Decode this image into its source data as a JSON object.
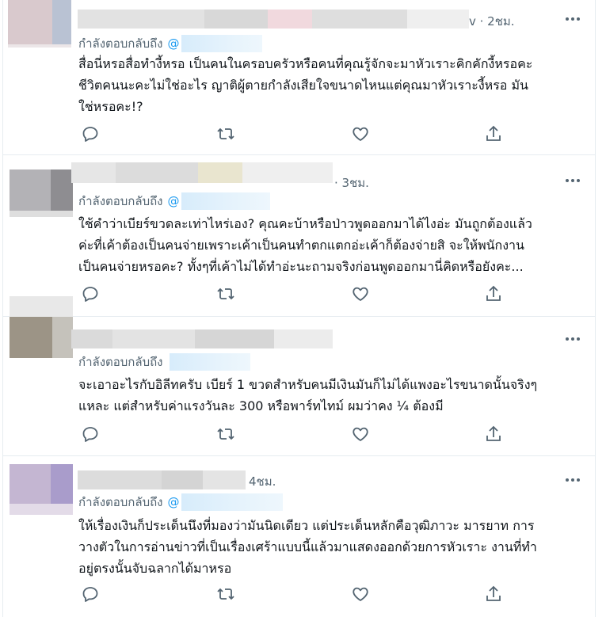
{
  "tweets": [
    {
      "time": "v · 2ชม.",
      "replying_to_label": "กำลังตอบกลับถึง",
      "at": "@",
      "lines": [
        "สื่อนี่หรอสื่อทำงี้หรอ เป็นคนในครอบครัวหรือคนที่คุณรู้จักจะมาหัวเราะคิกคักงี้หรอคะ",
        "ชีวิตคนนะคะไม่ใช่อะไร ญาติผู้ตายกำลังเสียใจขนาดไหนแต่คุณมาหัวเราะงี้หรอ มัน",
        "ใช่หรอคะ!?"
      ]
    },
    {
      "time": "· 3ชม.",
      "replying_to_label": "กำลังตอบกลับถึง",
      "at": "@",
      "lines": [
        "ใช้คำว่าเบียร์ขวดละเท่าไหร่เอง? คุณคะบ้าหรือป่าวพูดออกมาได้ไงอ่ะ มันถูกต้องแล้ว",
        "ค่ะที่เค้าต้องเป็นคนจ่ายเพราะเค้าเป็นคนทำตกแตกอ่ะเค้าก็ต้องจ่ายสิ จะให้พนักงาน",
        "เป็นคนจ่ายหรอคะ? ทั้งๆที่เค้าไม่ได้ทำอ่ะนะถามจริงก่อนพูดออกมานี่คิดหรือยังคะ..."
      ]
    },
    {
      "time": "",
      "replying_to_label": "กำลังตอบกลับถึง",
      "at": "",
      "lines": [
        "จะเอาอะไรกับอิลีทครับ เบียร์ 1 ขวดสำหรับคนมีเงินมันก็ไม่ได้แพงอะไรขนาดนั้นจริงๆ",
        "แหละ แต่สำหรับค่าแรงวันละ 300 หรือพาร์ทไทม์ ผมว่าคง ¼ ต้องมี"
      ]
    },
    {
      "time": "4ชม.",
      "replying_to_label": "กำลังตอบกลับถึง",
      "at": "@",
      "lines": [
        "ให้เรื่องเงินก็ประเด็นนึงที่มองว่ามันนิดเดียว แต่ประเด็นหลักคือวุฒิภาวะ มารยาท การ",
        "วางตัวในการอ่านข่าวที่เป็นเรื่องเศร้าแบบนี้แล้วมาแสดงออกด้วยการหัวเราะ งานที่ทำ",
        "อยู่ตรงนั้นจับฉลากได้มาหรอ"
      ]
    }
  ],
  "icons": {
    "more": "more-horizontal-icon",
    "reply": "reply-icon",
    "retweet": "retweet-icon",
    "like": "heart-icon",
    "share": "share-icon"
  },
  "colors": {
    "text": "#0f1419",
    "secondary": "#536471",
    "mention": "#1d9bf0",
    "divider": "#e6ecf0"
  }
}
